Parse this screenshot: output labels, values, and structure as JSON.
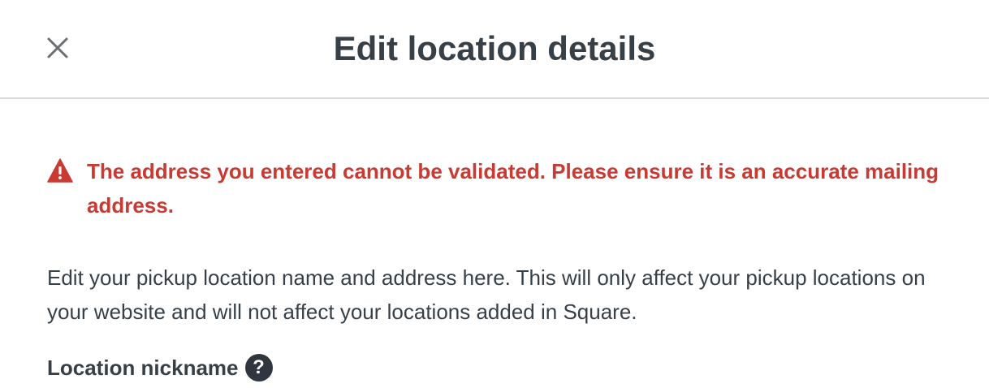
{
  "header": {
    "title": "Edit location details",
    "close_icon": "close-icon"
  },
  "alert": {
    "icon": "warning-icon",
    "color": "#c93a32",
    "message": "The address you entered cannot be validated. Please ensure it is an accurate mailing address."
  },
  "description": "Edit your pickup location name and address here. This will only affect your pickup locations on your website and will not affect your locations added in Square.",
  "fields": {
    "nickname_label": "Location nickname",
    "nickname_help_icon": "question-icon",
    "help_glyph": "?"
  },
  "colors": {
    "text": "#373f47",
    "error": "#c93a32",
    "divider": "#d9d9d9"
  }
}
